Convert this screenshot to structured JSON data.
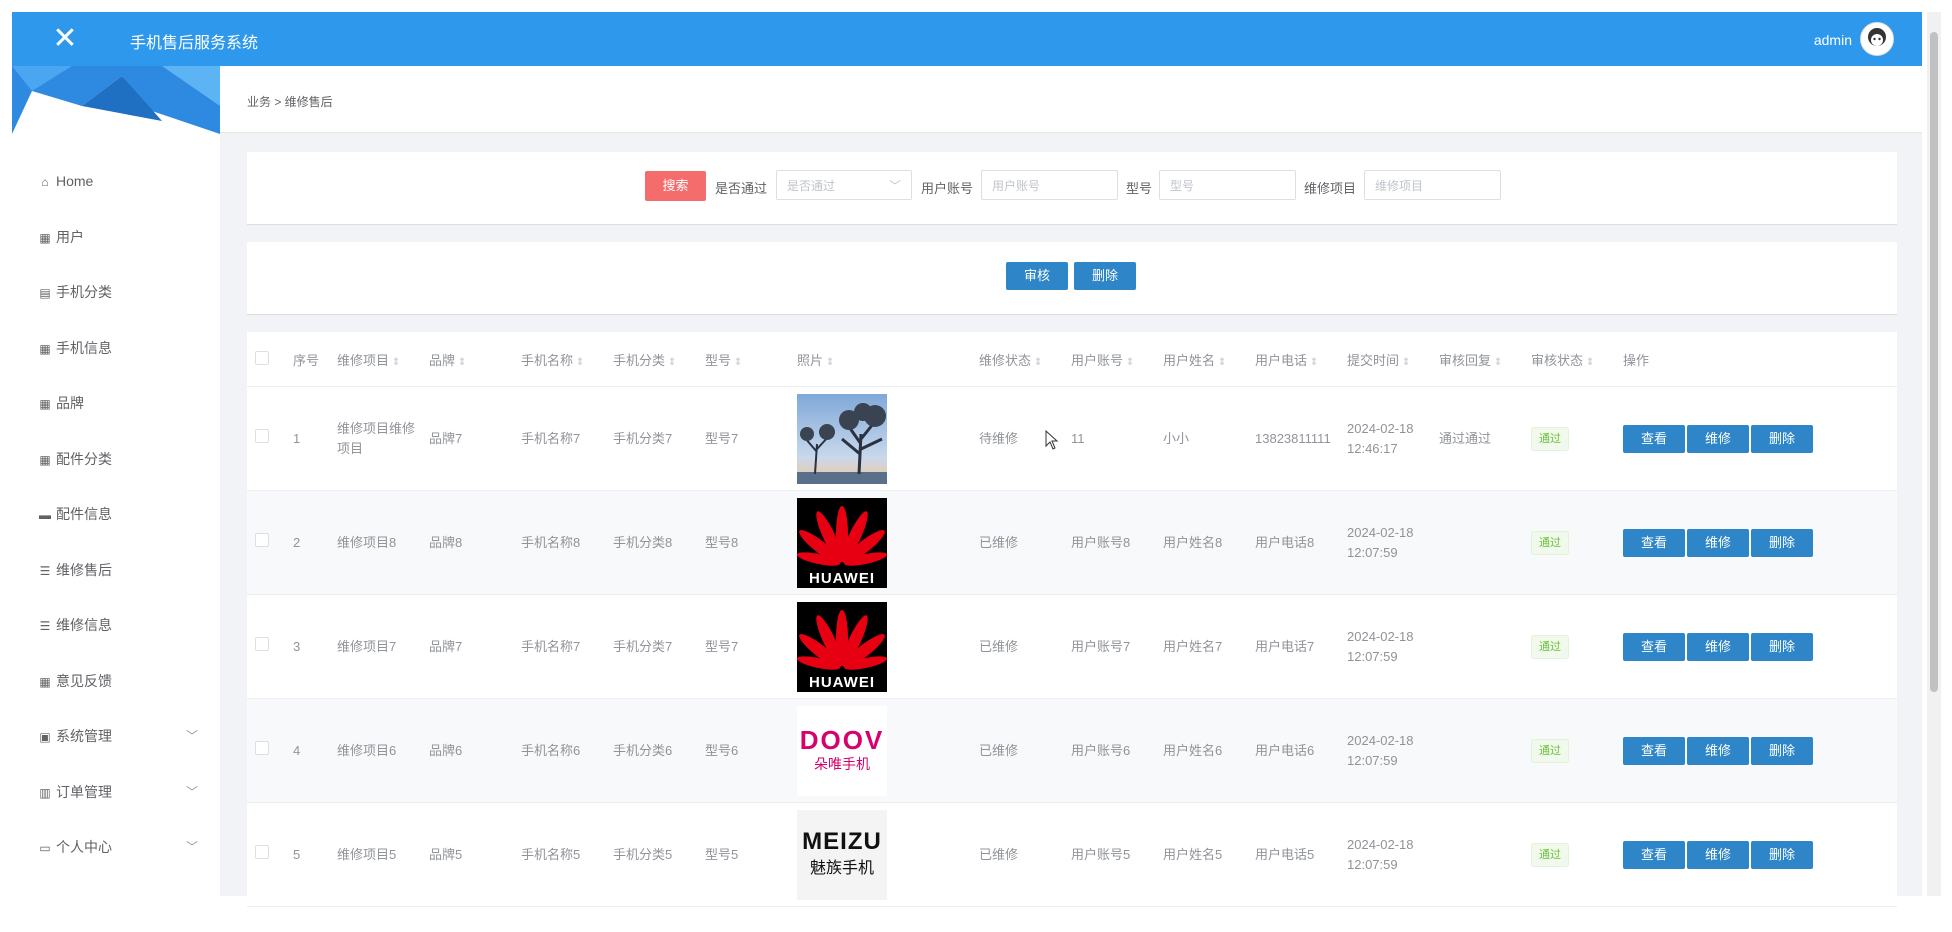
{
  "header": {
    "title": "手机售后服务系统",
    "user": "admin"
  },
  "breadcrumb": "业务 > 维修售后",
  "sidebar": {
    "items": [
      {
        "icon": "home-icon",
        "label": "Home"
      },
      {
        "icon": "grid-icon",
        "label": "用户"
      },
      {
        "icon": "phone-icon",
        "label": "手机分类"
      },
      {
        "icon": "grid-icon",
        "label": "手机信息"
      },
      {
        "icon": "grid-icon",
        "label": "品牌"
      },
      {
        "icon": "grid-icon",
        "label": "配件分类"
      },
      {
        "icon": "message-icon",
        "label": "配件信息"
      },
      {
        "icon": "list-icon",
        "label": "维修售后"
      },
      {
        "icon": "list-icon",
        "label": "维修信息"
      },
      {
        "icon": "grid-icon",
        "label": "意见反馈"
      },
      {
        "icon": "briefcase-icon",
        "label": "系统管理",
        "expandable": true
      },
      {
        "icon": "clipboard-icon",
        "label": "订单管理",
        "expandable": true
      },
      {
        "icon": "calendar-icon",
        "label": "个人中心",
        "expandable": true
      }
    ]
  },
  "search": {
    "button": "搜索",
    "passed_label": "是否通过",
    "passed_placeholder": "是否通过",
    "account_label": "用户账号",
    "account_placeholder": "用户账号",
    "model_label": "型号",
    "model_placeholder": "型号",
    "item_label": "维修项目",
    "item_placeholder": "维修项目"
  },
  "actions": {
    "audit": "审核",
    "delete": "删除"
  },
  "table": {
    "columns": [
      "序号",
      "维修项目",
      "品牌",
      "手机名称",
      "手机分类",
      "型号",
      "照片",
      "维修状态",
      "用户账号",
      "用户姓名",
      "用户电话",
      "提交时间",
      "审核回复",
      "审核状态",
      "操作"
    ],
    "rows": [
      {
        "index": "1",
        "item": "维修项目维修项目",
        "brand": "品牌7",
        "name": "手机名称7",
        "category": "手机分类7",
        "model": "型号7",
        "photo": "tree-photo",
        "status": "待维修",
        "account": "11",
        "username": "小小",
        "phone": "13823811111",
        "time": "2024-02-18 12:46:17",
        "reply": "通过通过",
        "audit": "通过"
      },
      {
        "index": "2",
        "item": "维修项目8",
        "brand": "品牌8",
        "name": "手机名称8",
        "category": "手机分类8",
        "model": "型号8",
        "photo": "huawei-logo",
        "status": "已维修",
        "account": "用户账号8",
        "username": "用户姓名8",
        "phone": "用户电话8",
        "time": "2024-02-18 12:07:59",
        "reply": "",
        "audit": "通过"
      },
      {
        "index": "3",
        "item": "维修项目7",
        "brand": "品牌7",
        "name": "手机名称7",
        "category": "手机分类7",
        "model": "型号7",
        "photo": "huawei-logo",
        "status": "已维修",
        "account": "用户账号7",
        "username": "用户姓名7",
        "phone": "用户电话7",
        "time": "2024-02-18 12:07:59",
        "reply": "",
        "audit": "通过"
      },
      {
        "index": "4",
        "item": "维修项目6",
        "brand": "品牌6",
        "name": "手机名称6",
        "category": "手机分类6",
        "model": "型号6",
        "photo": "doov-logo",
        "status": "已维修",
        "account": "用户账号6",
        "username": "用户姓名6",
        "phone": "用户电话6",
        "time": "2024-02-18 12:07:59",
        "reply": "",
        "audit": "通过"
      },
      {
        "index": "5",
        "item": "维修项目5",
        "brand": "品牌5",
        "name": "手机名称5",
        "category": "手机分类5",
        "model": "型号5",
        "photo": "meizu-logo",
        "status": "已维修",
        "account": "用户账号5",
        "username": "用户姓名5",
        "phone": "用户电话5",
        "time": "2024-02-18 12:07:59",
        "reply": "",
        "audit": "通过"
      }
    ],
    "row_actions": {
      "view": "查看",
      "repair": "维修",
      "delete": "删除"
    }
  },
  "logos": {
    "huawei_text": "HUAWEI",
    "doov_text": "DOOV",
    "doov_sub": "朵唯手机",
    "meizu_text": "MEIZU",
    "meizu_sub": "魅族手机"
  },
  "colors": {
    "header": "#2e98ec",
    "primary_button": "#2e85c8",
    "search_button": "#f56c6c",
    "pass_tag": "#67c23a"
  }
}
